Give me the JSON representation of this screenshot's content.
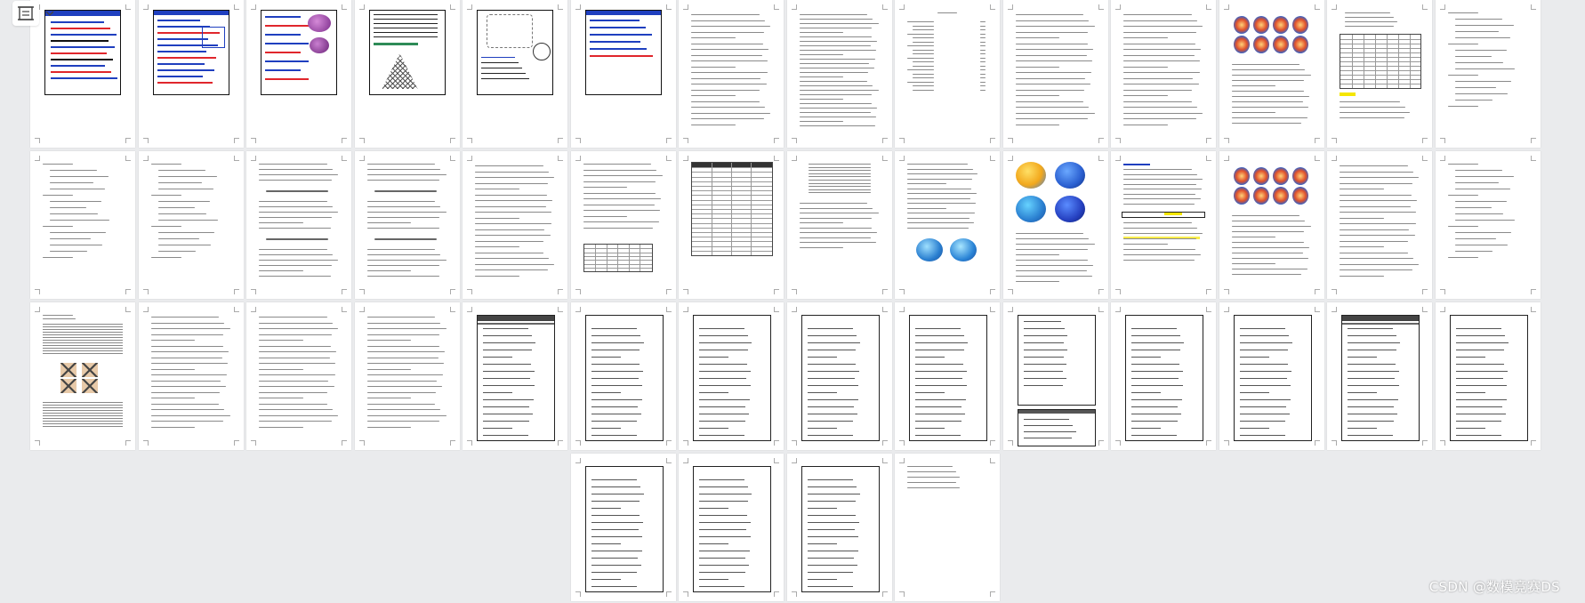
{
  "toolbar": {
    "page_view_icon": "page-view-icon",
    "dropdown_icon": "chevron-down-icon"
  },
  "watermark": "CSDN @数模竞赛DS",
  "colors": {
    "background": "#eaebed",
    "page": "#ffffff",
    "slide_blue": "#1f3fbf",
    "highlight_red": "#e0262c",
    "highlight_yellow": "#f5e600",
    "accent_green": "#2e8b57"
  },
  "pages": [
    {
      "kind": "slide",
      "variant": "slide-a"
    },
    {
      "kind": "slide",
      "variant": "slide-b"
    },
    {
      "kind": "slide",
      "variant": "slide-c"
    },
    {
      "kind": "slide",
      "variant": "slide-d"
    },
    {
      "kind": "slide",
      "variant": "slide-e"
    },
    {
      "kind": "slide",
      "variant": "slide-f"
    },
    {
      "kind": "text",
      "variant": "text"
    },
    {
      "kind": "text",
      "variant": "text-dense"
    },
    {
      "kind": "text",
      "variant": "toc"
    },
    {
      "kind": "text",
      "variant": "text"
    },
    {
      "kind": "text",
      "variant": "text"
    },
    {
      "kind": "figure",
      "variant": "blobs-top"
    },
    {
      "kind": "text",
      "variant": "table-page"
    },
    {
      "kind": "text",
      "variant": "list-page"
    },
    {
      "kind": "text",
      "variant": "list-page"
    },
    {
      "kind": "text",
      "variant": "list-page"
    },
    {
      "kind": "text",
      "variant": "formula"
    },
    {
      "kind": "text",
      "variant": "formula"
    },
    {
      "kind": "text",
      "variant": "text"
    },
    {
      "kind": "text",
      "variant": "table-bottom"
    },
    {
      "kind": "text",
      "variant": "big-table"
    },
    {
      "kind": "text",
      "variant": "dense-table"
    },
    {
      "kind": "figure",
      "variant": "spheres-bottom"
    },
    {
      "kind": "figure",
      "variant": "spheres-four"
    },
    {
      "kind": "text",
      "variant": "highlight-page"
    },
    {
      "kind": "figure",
      "variant": "blobs-top"
    },
    {
      "kind": "text",
      "variant": "text"
    },
    {
      "kind": "text",
      "variant": "list-page"
    },
    {
      "kind": "figure",
      "variant": "crosses"
    },
    {
      "kind": "text",
      "variant": "text"
    },
    {
      "kind": "text",
      "variant": "text"
    },
    {
      "kind": "text",
      "variant": "text"
    },
    {
      "kind": "code",
      "variant": "code-header"
    },
    {
      "kind": "code",
      "variant": "code"
    },
    {
      "kind": "code",
      "variant": "code"
    },
    {
      "kind": "code",
      "variant": "code"
    },
    {
      "kind": "code",
      "variant": "code"
    },
    {
      "kind": "code",
      "variant": "code-split"
    },
    {
      "kind": "code",
      "variant": "code"
    },
    {
      "kind": "code",
      "variant": "code"
    },
    {
      "kind": "code",
      "variant": "code-header"
    },
    {
      "kind": "code",
      "variant": "code"
    },
    {
      "kind": "code",
      "variant": "code"
    },
    {
      "kind": "code",
      "variant": "code"
    },
    {
      "kind": "code",
      "variant": "code"
    },
    {
      "kind": "text",
      "variant": "short-text"
    }
  ]
}
